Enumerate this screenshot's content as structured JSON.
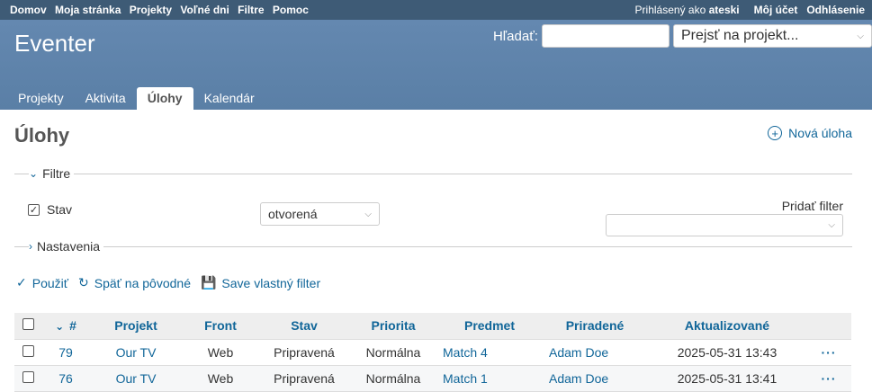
{
  "top_menu": {
    "items": [
      "Domov",
      "Moja stránka",
      "Projekty",
      "Voľné dni",
      "Filtre",
      "Pomoc"
    ],
    "logged_prefix": "Prihlásený ako",
    "logged_user": "ateski",
    "account": "Môj účet",
    "logout": "Odhlásenie"
  },
  "header": {
    "title": "Eventer",
    "search_label": "Hľadať:",
    "search_value": "",
    "project_jump": "Prejsť na projekt..."
  },
  "main_menu": {
    "tabs": [
      "Projekty",
      "Aktivita",
      "Úlohy",
      "Kalendár"
    ],
    "selected": "Úlohy"
  },
  "page": {
    "title": "Úlohy",
    "new_issue": "Nová úloha"
  },
  "filters": {
    "legend": "Filtre",
    "stav_label": "Stav",
    "stav_checked": true,
    "stav_operator": "otvorená",
    "add_filter_label": "Pridať filter",
    "add_filter_value": ""
  },
  "options": {
    "legend": "Nastavenia"
  },
  "buttons": {
    "apply": "Použiť",
    "reset": "Späť na pôvodné",
    "save": "Save vlastný filter"
  },
  "table": {
    "headers": [
      "#",
      "Projekt",
      "Front",
      "Stav",
      "Priorita",
      "Predmet",
      "Priradené",
      "Aktualizované"
    ],
    "rows": [
      {
        "id": "79",
        "project": "Our TV",
        "tracker": "Web",
        "status": "Pripravená",
        "priority": "Normálna",
        "subject": "Match 4",
        "assignee": "Adam Doe",
        "updated": "2025-05-31 13:43",
        "menu": "···"
      },
      {
        "id": "76",
        "project": "Our TV",
        "tracker": "Web",
        "status": "Pripravená",
        "priority": "Normálna",
        "subject": "Match 1",
        "assignee": "Adam Doe",
        "updated": "2025-05-31 13:41",
        "menu": "···"
      }
    ]
  },
  "colors": {
    "top_bar": "#3e5b76",
    "header": "#628db6",
    "link": "#116699"
  }
}
